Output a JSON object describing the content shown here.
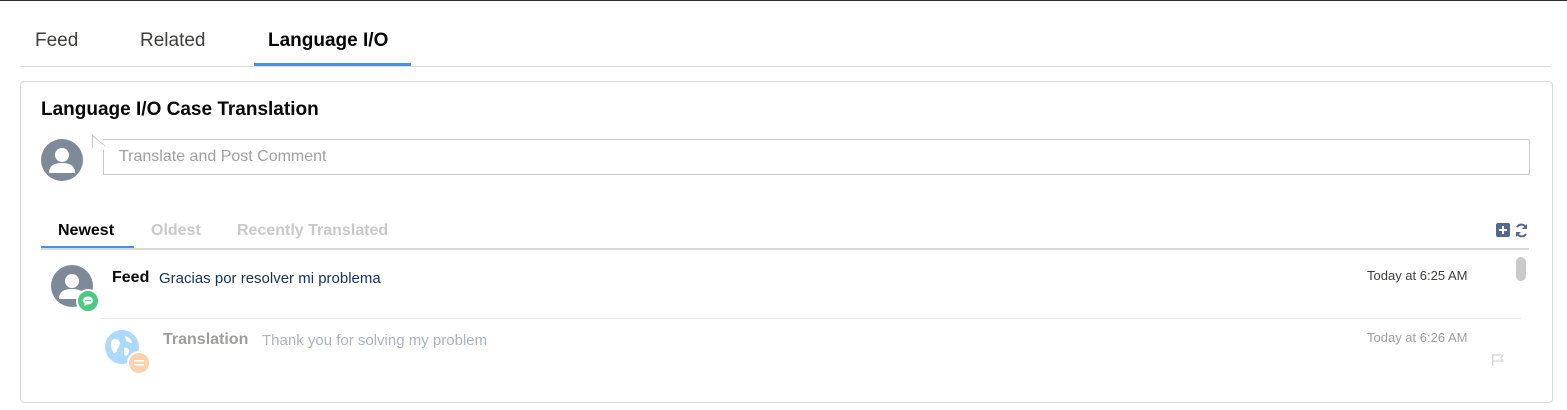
{
  "tabs": [
    {
      "label": "Feed",
      "active": false
    },
    {
      "label": "Related",
      "active": false
    },
    {
      "label": "Language I/O",
      "active": true
    }
  ],
  "card": {
    "title": "Language I/O Case Translation",
    "composer_placeholder": "Translate and Post Comment"
  },
  "sort_tabs": [
    {
      "label": "Newest",
      "active": true
    },
    {
      "label": "Oldest",
      "active": false
    },
    {
      "label": "Recently Translated",
      "active": false
    }
  ],
  "toolbar": {
    "add_icon": "add-square-icon",
    "refresh_icon": "refresh-icon"
  },
  "feed_items": [
    {
      "label": "Feed",
      "text": "Gracias por resolver mi problema",
      "time": "Today at 6:25 AM",
      "icon": "user-avatar-icon",
      "badge_icon": "chat-bubble-icon",
      "badge_color": "#4bca81"
    },
    {
      "label": "Translation",
      "text": "Thank you for solving my problem",
      "time": "Today at 6:26 AM",
      "icon": "globe-icon",
      "badge_icon": "translate-icon",
      "badge_color": "#f9a75d",
      "action_icon": "flag-icon"
    }
  ],
  "colors": {
    "accent": "#4a90e2",
    "avatar": "#7f8a99",
    "feed_text": "#16325c"
  }
}
